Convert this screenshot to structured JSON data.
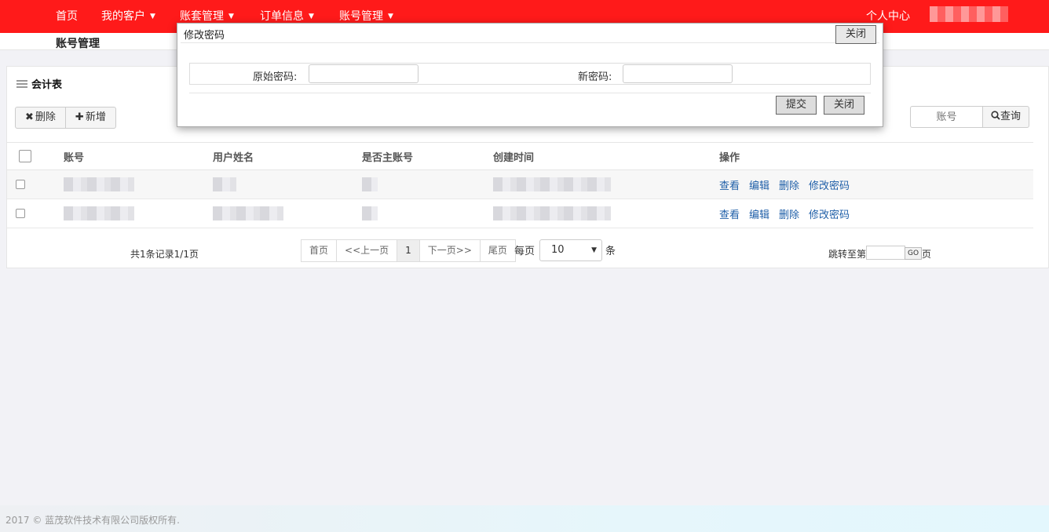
{
  "nav": {
    "items": [
      {
        "label": "首页",
        "caret": false
      },
      {
        "label": "我的客户",
        "caret": true
      },
      {
        "label": "账套管理",
        "caret": true
      },
      {
        "label": "订单信息",
        "caret": true
      },
      {
        "label": "账号管理",
        "caret": true
      }
    ],
    "user_center": "个人中心"
  },
  "page_title": "账号管理",
  "panel": {
    "heading": "会计表",
    "delete_label": "删除",
    "delete_icon": "✖",
    "add_label": "新增",
    "add_icon": "✚",
    "search_placeholder": "账号",
    "search_label": "查询"
  },
  "table": {
    "headers": [
      "账号",
      "用户姓名",
      "是否主账号",
      "创建时间",
      "操作"
    ],
    "actions": [
      "查看",
      "编辑",
      "删除",
      "修改密码"
    ]
  },
  "pagination": {
    "total_text": "共1条记录1/1页",
    "first": "首页",
    "prev": "<<上一页",
    "current": "1",
    "next": "下一页>>",
    "last": "尾页",
    "per_page_label": "每页",
    "per_page_value": "10",
    "per_page_unit": "条",
    "jump_label": "跳转至第",
    "go": "GO",
    "page_unit": "页"
  },
  "modal": {
    "title": "修改密码",
    "close_top": "关闭",
    "old_password_label": "原始密码:",
    "new_password_label": "新密码:",
    "submit": "提交",
    "close": "关闭"
  },
  "footer": {
    "copyright": "2017 © 蓝茂软件技术有限公司版权所有."
  },
  "colors": {
    "nav_bg": "#ff1a1a",
    "link": "#1f5fa8"
  }
}
